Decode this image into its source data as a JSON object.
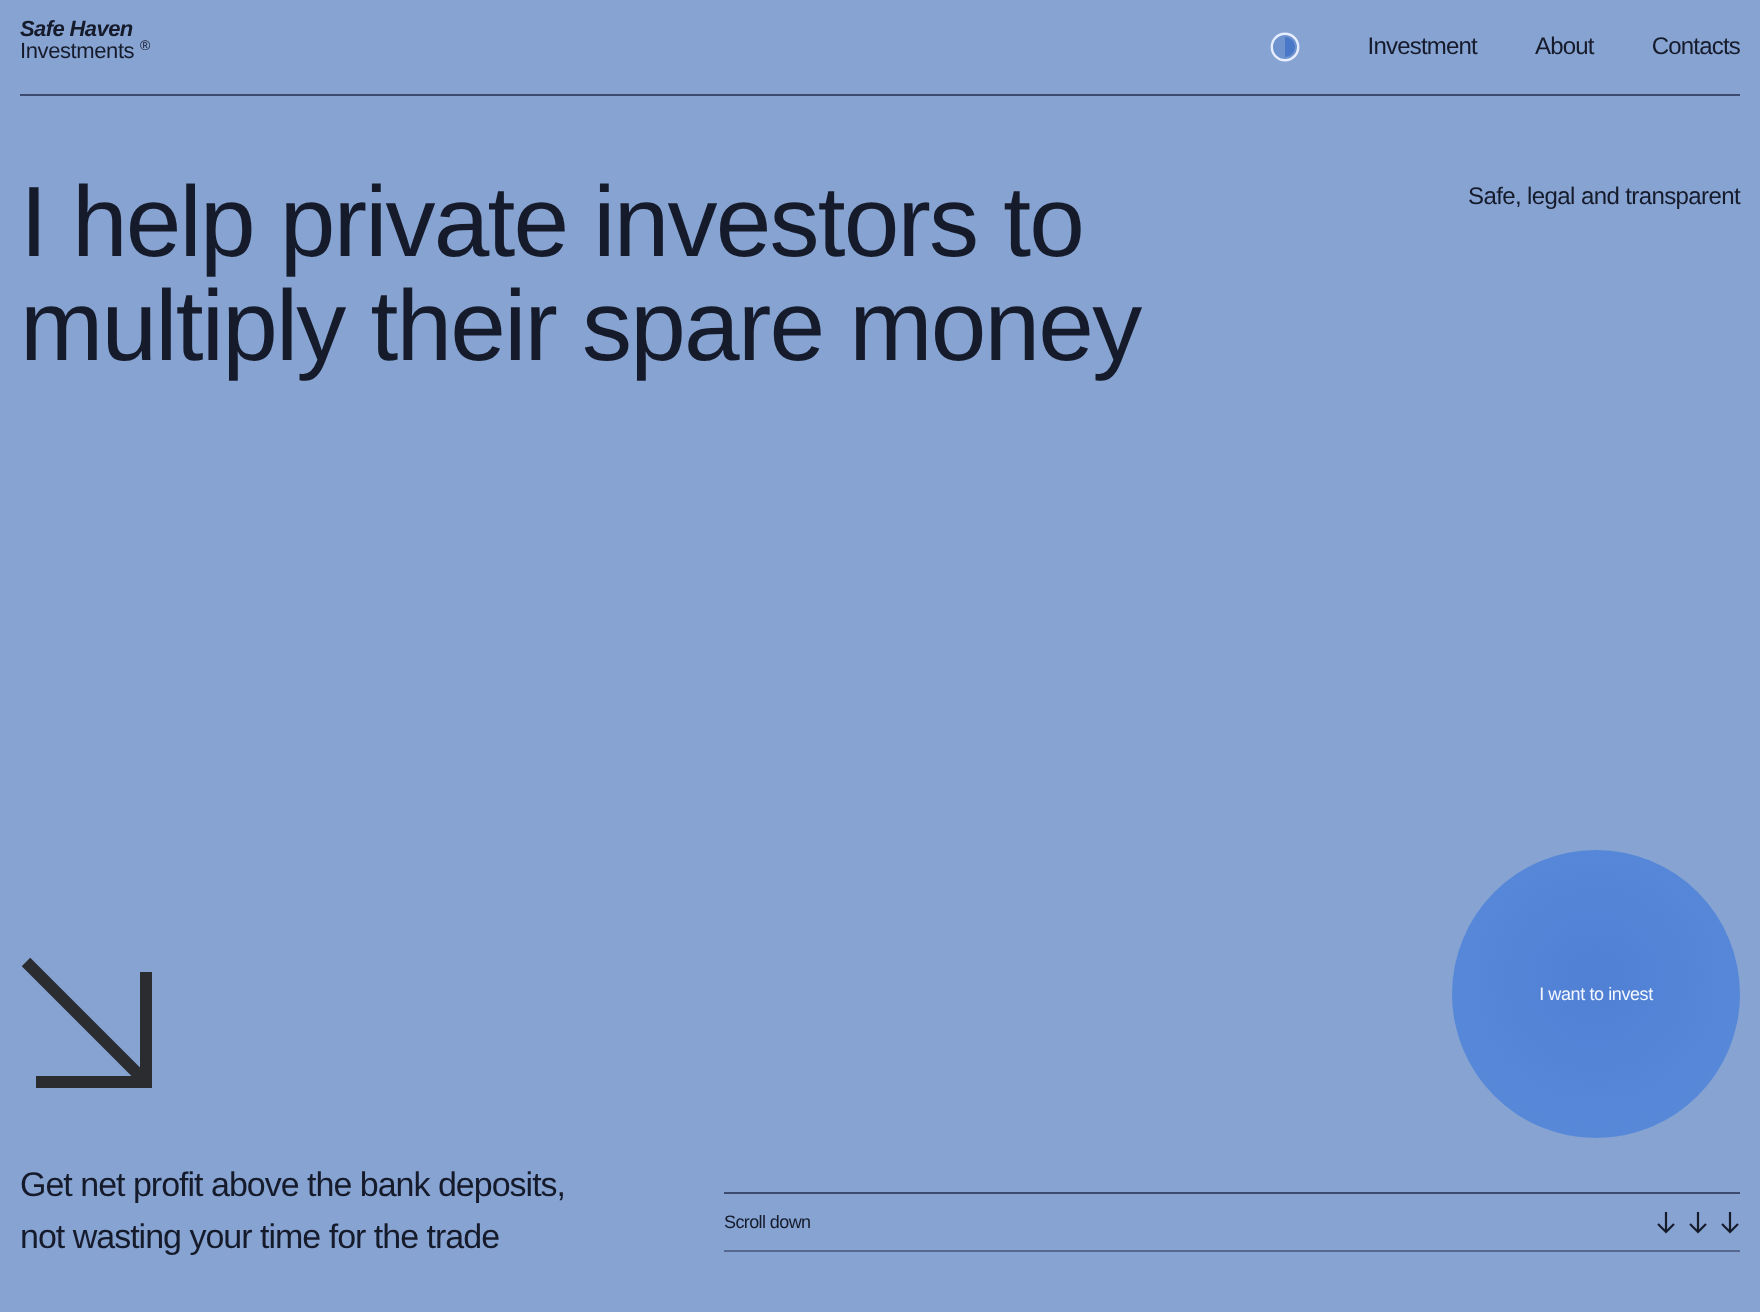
{
  "header": {
    "logo": {
      "title": "Safe Haven",
      "subtitle": "Investments $^{®}$"
    },
    "nav": [
      {
        "label": "Investment"
      },
      {
        "label": "About"
      },
      {
        "label": "Contacts"
      }
    ]
  },
  "hero": {
    "heading_lines": [
      "I help private investors to",
      "multiply their spare money"
    ],
    "tagline": "Safe, legal and transparent"
  },
  "intro": {
    "lines": [
      "Get net profit above the bank deposits,",
      "not wasting your time for the trade"
    ]
  },
  "cta": {
    "label": "I want to invest"
  },
  "scroll": {
    "label": "Scroll down"
  }
}
